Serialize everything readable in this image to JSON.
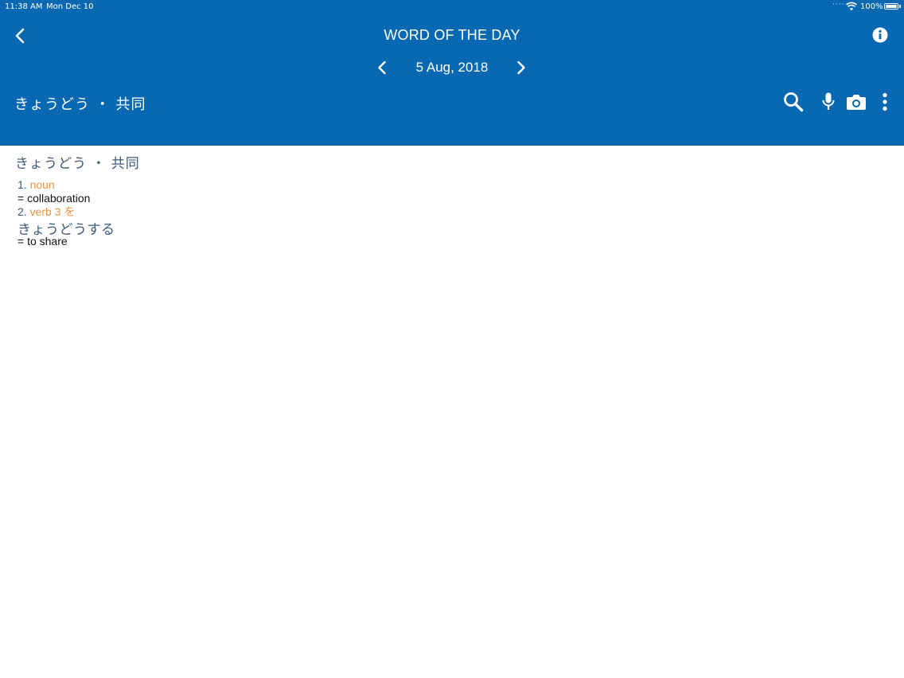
{
  "status_bar": {
    "time": "11:38 AM",
    "date": "Mon Dec 10",
    "battery": "100%"
  },
  "header": {
    "title": "WORD OF THE DAY",
    "date": "5 Aug, 2018",
    "search_query": "きょうどう ・ 共同"
  },
  "entry": {
    "headword": "きょうどう ・ 共同",
    "senses": [
      {
        "number": "1.",
        "pos": "noun",
        "gloss": "= collaboration"
      },
      {
        "number": "2.",
        "pos": "verb 3 を",
        "form": "きょうどうする",
        "gloss": "= to share"
      }
    ]
  },
  "colors": {
    "header_bg": "#0868b2",
    "headword": "#3e5a7a",
    "pos": "#f0903a"
  },
  "icons": [
    "back-icon",
    "info-icon",
    "chevron-left-icon",
    "chevron-right-icon",
    "search-icon",
    "microphone-icon",
    "camera-icon",
    "more-vertical-icon",
    "wifi-icon",
    "battery-icon"
  ]
}
